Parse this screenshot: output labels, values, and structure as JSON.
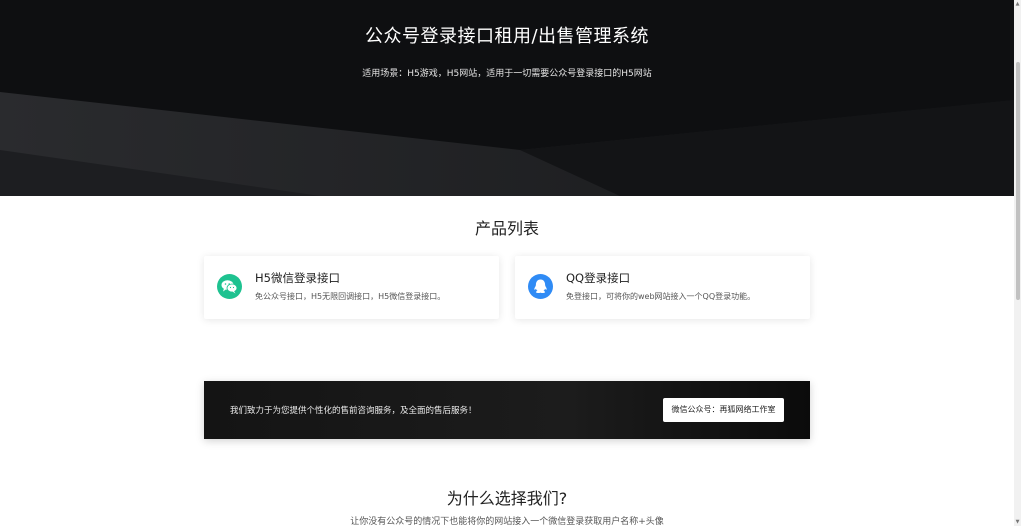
{
  "hero": {
    "title": "公众号登录接口租用/出售管理系统",
    "subtitle": "适用场景：H5游戏，H5网站，适用于一切需要公众号登录接口的H5网站"
  },
  "products": {
    "title": "产品列表",
    "items": [
      {
        "name": "H5微信登录接口",
        "desc": "免公众号接口，H5无限回调接口，H5微信登录接口。",
        "icon": "wechat-icon",
        "color": "#1ec290"
      },
      {
        "name": "QQ登录接口",
        "desc": "免登接口，可将你的web网站接入一个QQ登录功能。",
        "icon": "qq-icon",
        "color": "#2f8bf5"
      }
    ]
  },
  "banner": {
    "text": "我们致力于为您提供个性化的售前咨询服务，及全面的售后服务！",
    "button": "微信公众号：再狐网络工作室"
  },
  "why": {
    "title": "为什么选择我们?",
    "subtitle": "让你没有公众号的情况下也能将你的网站接入一个微信登录获取用户名称+头像"
  }
}
